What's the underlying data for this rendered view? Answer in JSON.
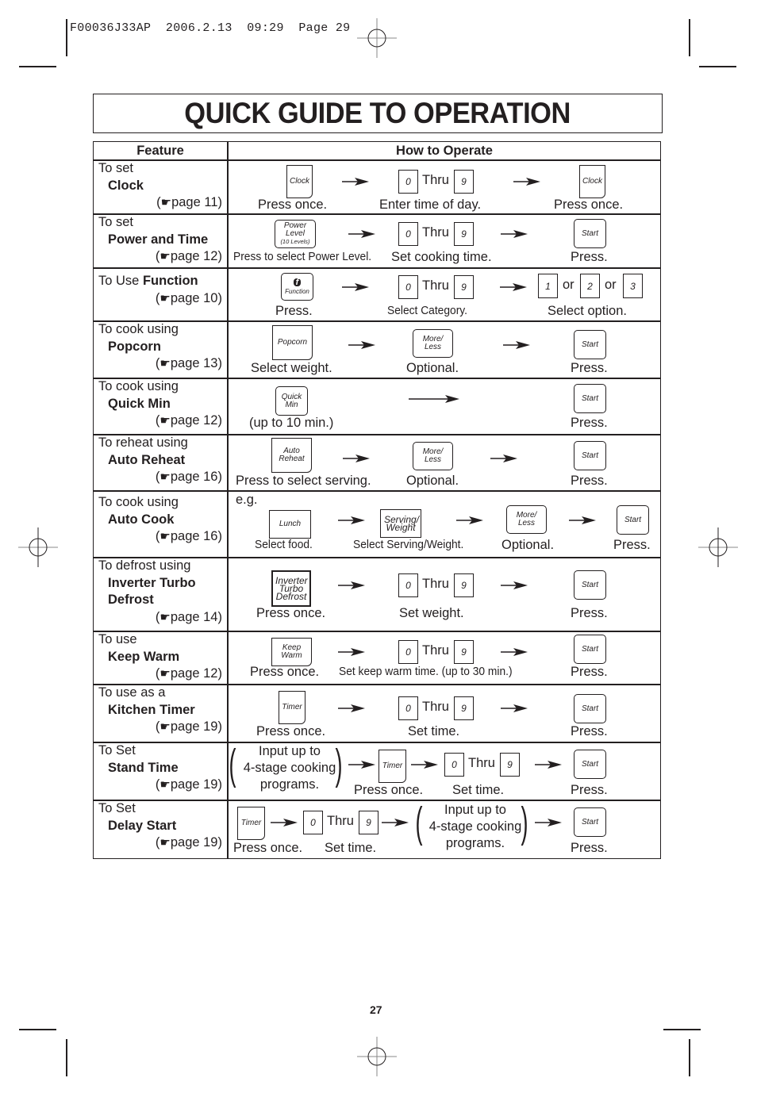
{
  "slug_line": "F00036J33AP  2006.2.13  09:29  Page 29",
  "title": "QUICK GUIDE TO OPERATION",
  "table": {
    "headers": {
      "feature": "Feature",
      "how": "How to Operate"
    },
    "page_ref_icon": "pointing-hand-icon",
    "rows": [
      {
        "intro": "To set",
        "feature": "Clock",
        "page_ref": "page 11",
        "keys": [
          "Clock",
          "0",
          "Thru",
          "9",
          "Clock"
        ],
        "captions": [
          "Press once.",
          "Enter time of day.",
          "Press once."
        ]
      },
      {
        "intro": "To set",
        "feature": "Power and Time",
        "page_ref": "page 12",
        "keys": [
          "Power Level",
          "(10 Levels)",
          "0",
          "Thru",
          "9",
          "Start"
        ],
        "captions": [
          "Press to select Power Level.",
          "Set cooking time.",
          "Press."
        ]
      },
      {
        "intro": "To Use",
        "feature": "Function",
        "page_ref": "page 10",
        "keys": [
          "f",
          "Function",
          "0",
          "Thru",
          "9",
          "1",
          "or",
          "2",
          "or",
          "3"
        ],
        "captions": [
          "Press.",
          "Select Category.",
          "Select option."
        ]
      },
      {
        "intro": "To cook using",
        "feature": "Popcorn",
        "page_ref": "page 13",
        "keys": [
          "Popcorn",
          "More/ Less",
          "Start"
        ],
        "captions": [
          "Select weight.",
          "Optional.",
          "Press."
        ]
      },
      {
        "intro": "To cook using",
        "feature": "Quick Min",
        "page_ref": "page 12",
        "keys": [
          "Quick Min",
          "Start"
        ],
        "captions": [
          "(up to 10 min.)",
          "Press."
        ]
      },
      {
        "intro": "To reheat using",
        "feature": "Auto Reheat",
        "page_ref": "page 16",
        "keys": [
          "Auto Reheat",
          "More/ Less",
          "Start"
        ],
        "captions": [
          "Press to select serving.",
          "Optional.",
          "Press."
        ]
      },
      {
        "intro": "To cook using",
        "feature": "Auto Cook",
        "page_ref": "page 16",
        "eg": "e.g.",
        "keys": [
          "Lunch",
          "Serving/ Weight",
          "More/ Less",
          "Start"
        ],
        "captions": [
          "Select food.",
          "Select Serving/Weight.",
          "Optional.",
          "Press."
        ]
      },
      {
        "intro": "To defrost using",
        "feature": "Inverter Turbo",
        "feature2": "Defrost",
        "page_ref": "page 14",
        "keys": [
          "Inverter Turbo Defrost",
          "0",
          "Thru",
          "9",
          "Start"
        ],
        "captions": [
          "Press once.",
          "Set weight.",
          "Press."
        ]
      },
      {
        "intro": "To use",
        "feature": "Keep Warm",
        "page_ref": "page 12",
        "keys": [
          "Keep Warm",
          "0",
          "Thru",
          "9",
          "Start"
        ],
        "captions": [
          "Press once.",
          "Set keep warm time. (up to 30 min.)",
          "Press."
        ]
      },
      {
        "intro": "To use as a",
        "feature": "Kitchen Timer",
        "page_ref": "page 19",
        "keys": [
          "Timer",
          "0",
          "Thru",
          "9",
          "Start"
        ],
        "captions": [
          "Press once.",
          "Set time.",
          "Press."
        ]
      },
      {
        "intro": "To Set",
        "feature": "Stand Time",
        "page_ref": "page 19",
        "note": [
          "Input up to",
          "4-stage cooking",
          "programs."
        ],
        "keys": [
          "Timer",
          "0",
          "Thru",
          "9",
          "Start"
        ],
        "captions": [
          "Press once.",
          "Set time.",
          "Press."
        ]
      },
      {
        "intro": "To Set",
        "feature": "Delay Start",
        "page_ref": "page 19",
        "note": [
          "Input up to",
          "4-stage cooking",
          "programs."
        ],
        "keys": [
          "Timer",
          "0",
          "Thru",
          "9",
          "Start"
        ],
        "captions": [
          "Press once.",
          "Set time.",
          "Press."
        ]
      }
    ]
  },
  "page_number": "27"
}
